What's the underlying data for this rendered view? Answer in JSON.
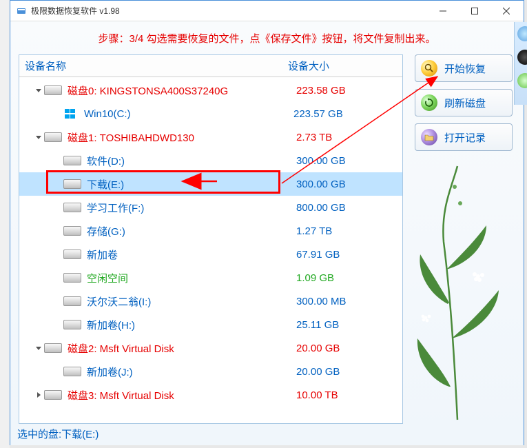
{
  "titlebar": {
    "title": "极限数据恢复软件 v1.98"
  },
  "step_instruction": "步骤：3/4 勾选需要恢复的文件，点《保存文件》按钮，将文件复制出来。",
  "table_headers": {
    "name": "设备名称",
    "size": "设备大小"
  },
  "buttons": {
    "start_recovery": "开始恢复",
    "refresh_disks": "刷新磁盘",
    "open_log": "打开记录"
  },
  "rows": [
    {
      "level": 0,
      "expanded": true,
      "icon": "disk",
      "name": "磁盘0: KINGSTONSA400S37240G",
      "size": "223.58 GB",
      "color": "red"
    },
    {
      "level": 1,
      "icon": "win",
      "name": "Win10(C:)",
      "size": "223.57 GB",
      "color": "blue"
    },
    {
      "level": 0,
      "expanded": true,
      "icon": "disk",
      "name": "磁盘1: TOSHIBAHDWD130",
      "size": "2.73 TB",
      "color": "red"
    },
    {
      "level": 1,
      "icon": "disk",
      "name": "软件(D:)",
      "size": "300.00 GB",
      "color": "blue"
    },
    {
      "level": 1,
      "icon": "disk",
      "name": "下载(E:)",
      "size": "300.00 GB",
      "color": "blue",
      "selected": true
    },
    {
      "level": 1,
      "icon": "disk",
      "name": "学习工作(F:)",
      "size": "800.00 GB",
      "color": "blue"
    },
    {
      "level": 1,
      "icon": "disk",
      "name": "存储(G:)",
      "size": "1.27 TB",
      "color": "blue"
    },
    {
      "level": 1,
      "icon": "disk",
      "name": "新加卷",
      "size": "67.91 GB",
      "color": "blue"
    },
    {
      "level": 1,
      "icon": "disk",
      "name": "空闲空间",
      "size": "1.09 GB",
      "color": "green"
    },
    {
      "level": 1,
      "icon": "disk",
      "name": "沃尔沃二翁(I:)",
      "size": "300.00 MB",
      "color": "blue"
    },
    {
      "level": 1,
      "icon": "disk",
      "name": "新加卷(H:)",
      "size": "25.11 GB",
      "color": "blue"
    },
    {
      "level": 0,
      "expanded": true,
      "icon": "disk",
      "name": "磁盘2: Msft     Virtual Disk",
      "size": "20.00 GB",
      "color": "red"
    },
    {
      "level": 1,
      "icon": "disk",
      "name": "新加卷(J:)",
      "size": "20.00 GB",
      "color": "blue"
    },
    {
      "level": 0,
      "expanded": false,
      "icon": "disk",
      "name": "磁盘3: Msft     Virtual Disk",
      "size": "10.00 TB",
      "color": "red"
    }
  ],
  "status_bar": "选中的盘:下载(E:)"
}
